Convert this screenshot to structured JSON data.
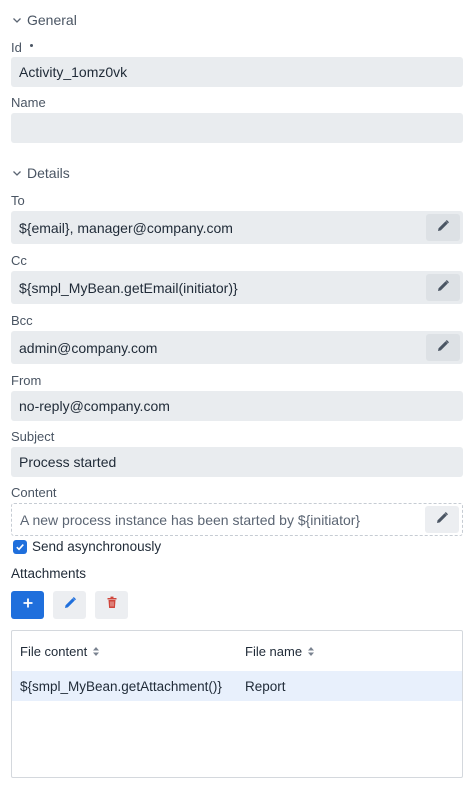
{
  "general": {
    "section_title": "General",
    "id_label": "Id",
    "id_value": "Activity_1omz0vk",
    "name_label": "Name",
    "name_value": ""
  },
  "details": {
    "section_title": "Details",
    "to_label": "To",
    "to_value": "${email}, manager@company.com",
    "cc_label": "Cc",
    "cc_value": "${smpl_MyBean.getEmail(initiator)}",
    "bcc_label": "Bcc",
    "bcc_value": "admin@company.com",
    "from_label": "From",
    "from_value": "no-reply@company.com",
    "subject_label": "Subject",
    "subject_value": "Process started",
    "content_label": "Content",
    "content_value": "A new process instance has been started by ${initiator}",
    "send_async_label": "Send asynchronously",
    "send_async_checked": true
  },
  "attachments": {
    "title": "Attachments",
    "columns": [
      "File content",
      "File name"
    ],
    "rows": [
      {
        "file_content": "${smpl_MyBean.getAttachment()}",
        "file_name": "Report"
      }
    ]
  },
  "colors": {
    "accent": "#1f6fdc",
    "field_bg": "#e9ecef",
    "selected_row": "#e8f0fc",
    "danger": "#d0453b"
  }
}
